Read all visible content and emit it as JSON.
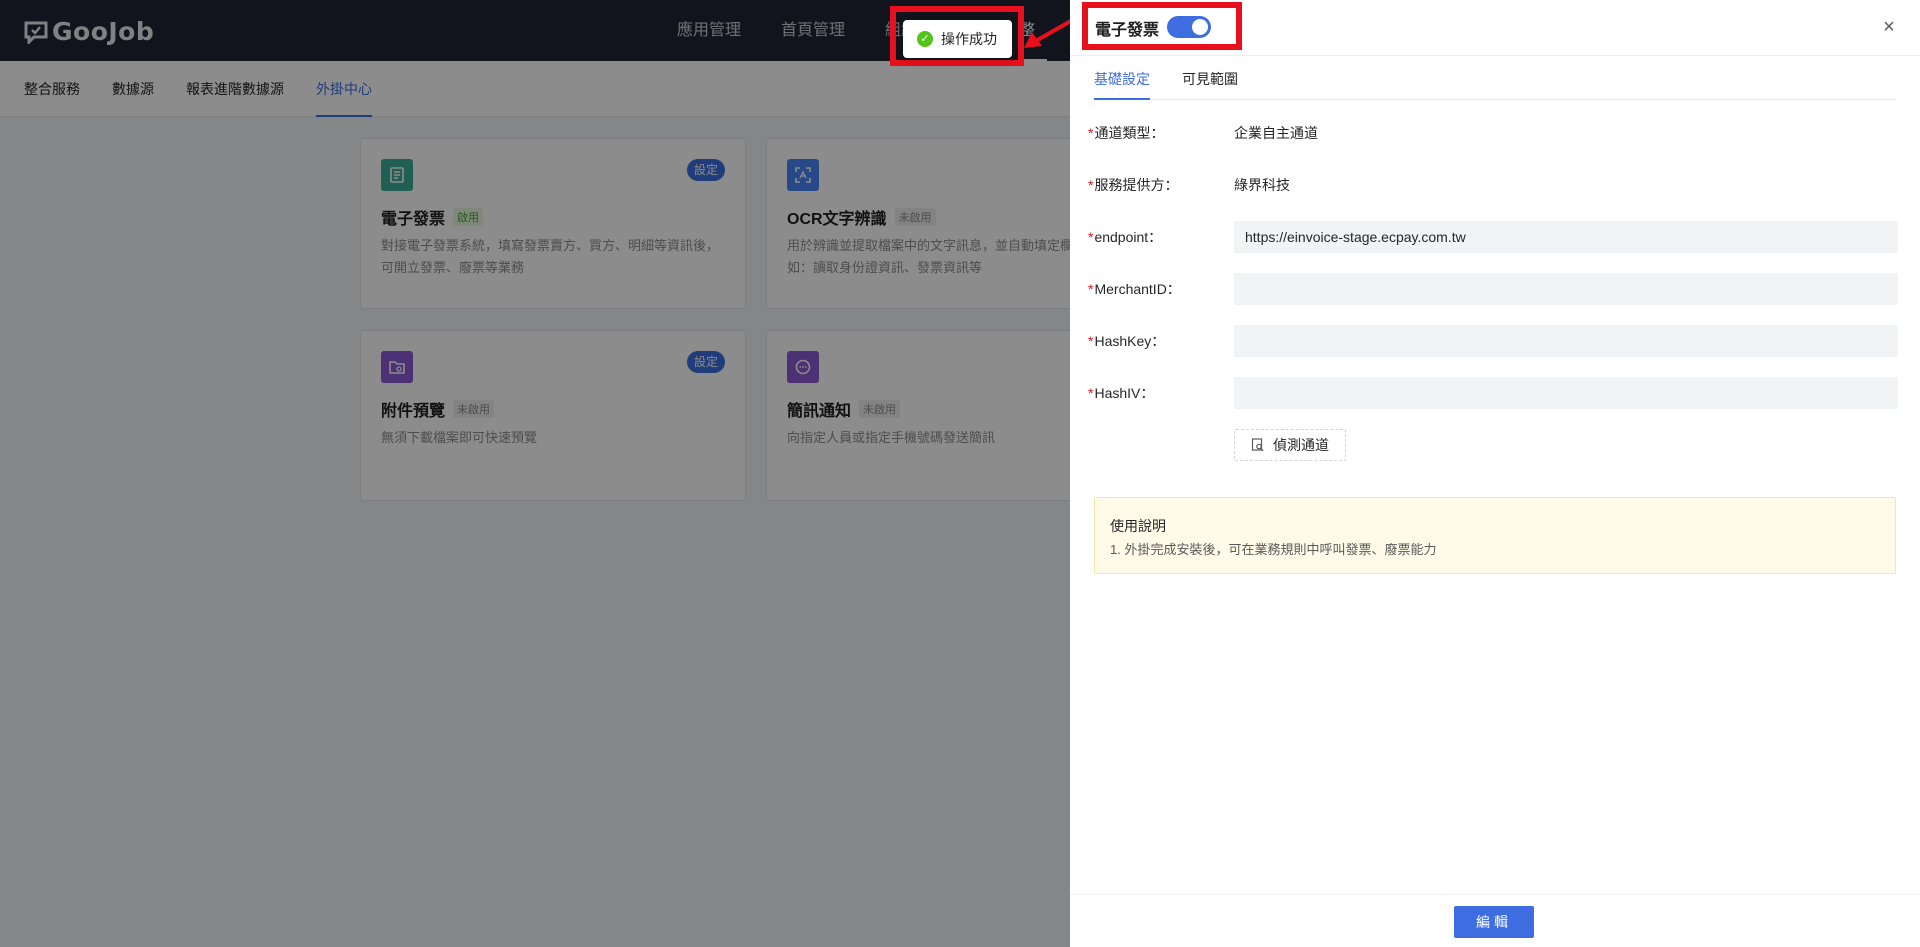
{
  "app": {
    "logo_text": "GooJob"
  },
  "top_nav": {
    "items": [
      "應用管理",
      "首頁管理",
      "組織",
      "整"
    ]
  },
  "sub_nav": {
    "items": [
      "整合服務",
      "數據源",
      "報表進階數據源",
      "外掛中心"
    ],
    "active": "外掛中心"
  },
  "cards": [
    {
      "title": "電子發票",
      "status": "啟用",
      "desc": "對接電子發票系統，填寫發票賣方、買方、明細等資訊後，可開立發票、廢票等業務",
      "setting_label": "設定",
      "icon": "invoice-icon",
      "icon_color": "#3dae9b"
    },
    {
      "title": "OCR文字辨識",
      "status": "未啟用",
      "desc": "用於辨識並提取檔案中的文字訊息，並自動填定欄位。例如：讀取身份證資訊、發票資訊等",
      "icon": "scan-icon",
      "icon_color": "#4a86f7"
    },
    {
      "title": "附件預覽",
      "status": "未啟用",
      "desc": "無須下載檔案即可快速預覽",
      "setting_label": "設定",
      "icon": "folder-icon",
      "icon_color": "#8a5ad6"
    },
    {
      "title": "簡訊通知",
      "status": "未啟用",
      "desc": "向指定人員或指定手機號碼發送簡訊",
      "icon": "message-icon",
      "icon_color": "#8a5ad6"
    }
  ],
  "toast": {
    "message": "操作成功",
    "color": "#52c41a"
  },
  "drawer": {
    "title": "電子發票",
    "toggle_on": true,
    "close_label": "×",
    "tabs": [
      "基礎設定",
      "可見範圍"
    ],
    "fields": [
      {
        "label": "通道類型：",
        "value": "企業自主通道",
        "type": "text"
      },
      {
        "label": "服務提供方：",
        "value": "綠界科技",
        "type": "text"
      },
      {
        "label": "endpoint：",
        "value": "https://einvoice-stage.ecpay.com.tw",
        "type": "input"
      },
      {
        "label": "MerchantID：",
        "value": "",
        "type": "input"
      },
      {
        "label": "HashKey：",
        "value": "",
        "type": "input"
      },
      {
        "label": "HashIV：",
        "value": "",
        "type": "input"
      }
    ],
    "required_mark": "*",
    "detect_label": "偵測通道",
    "notice_title": "使用說明",
    "notice_line": "1. 外掛完成安裝後，可在業務規則中呼叫發票、廢票能力",
    "edit_label": "編輯"
  },
  "colors": {
    "accent": "#3d6de0",
    "highlight": "#e8101c",
    "header_bg": "#202633"
  }
}
